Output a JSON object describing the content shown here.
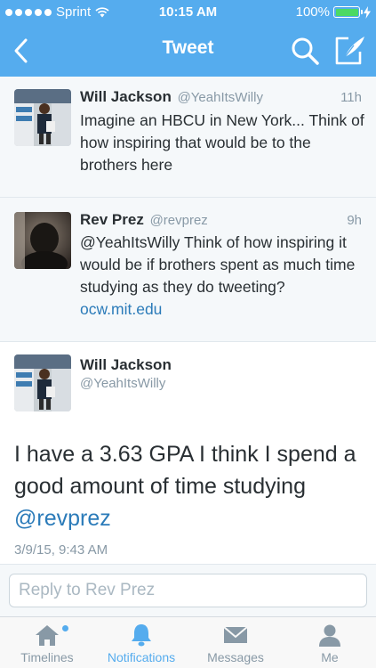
{
  "status_bar": {
    "carrier": "Sprint",
    "time": "10:15 AM",
    "battery": "100%"
  },
  "nav": {
    "title": "Tweet"
  },
  "tweets": [
    {
      "name": "Will Jackson",
      "handle": "@YeahItsWilly",
      "time_ago": "11h",
      "text": "Imagine an HBCU in New York... Think of how inspiring that would be to the brothers here"
    },
    {
      "name": "Rev Prez",
      "handle": "@revprez",
      "time_ago": "9h",
      "text": "@YeahItsWilly Think of how inspiring it would be if brothers spent as much time studying as they do tweeting?",
      "link": "ocw.mit.edu"
    }
  ],
  "main_tweet": {
    "name": "Will Jackson",
    "handle": "@YeahItsWilly",
    "text": "I have a 3.63 GPA I think I spend a good amount of time studying",
    "mention": "@revprez",
    "timestamp": "3/9/15, 9:43 AM"
  },
  "reply": {
    "placeholder": "Reply to Rev Prez"
  },
  "tabs": [
    {
      "label": "Timelines",
      "icon": "home-icon"
    },
    {
      "label": "Notifications",
      "icon": "bell-icon",
      "active": true
    },
    {
      "label": "Messages",
      "icon": "envelope-icon"
    },
    {
      "label": "Me",
      "icon": "person-icon"
    }
  ],
  "colors": {
    "brand": "#55acee",
    "link": "#2b7bb9",
    "battery": "#4cd964"
  }
}
